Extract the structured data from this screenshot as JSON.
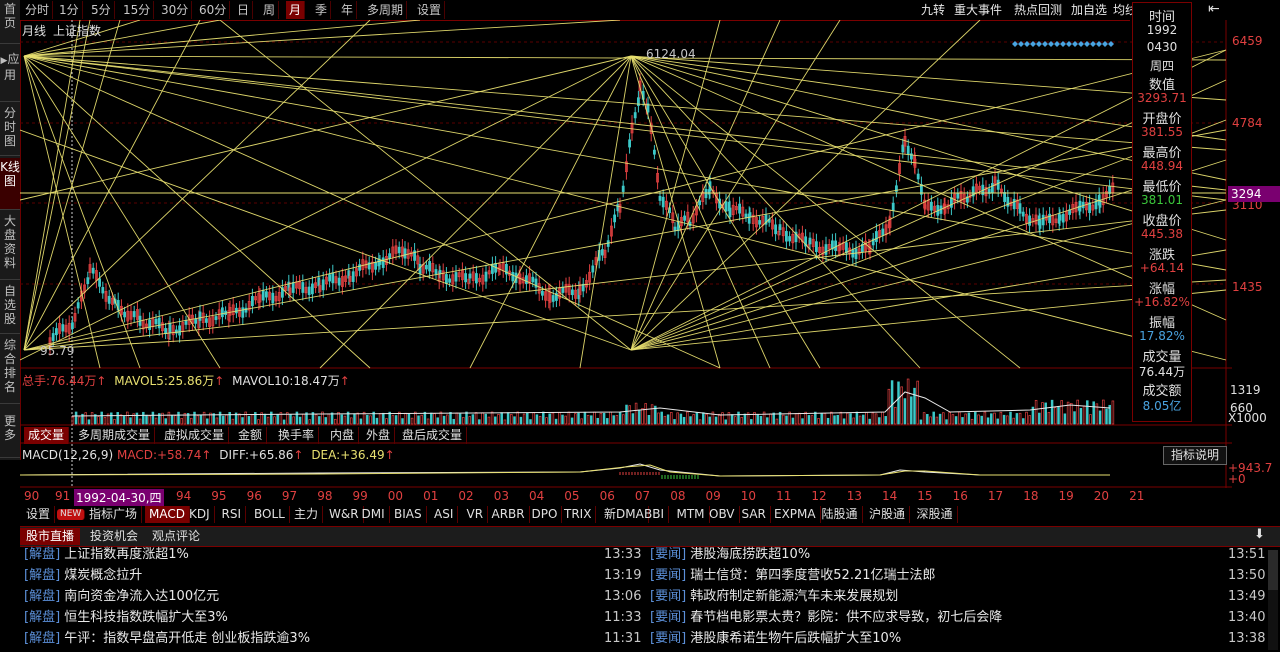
{
  "left_sidebar": [
    {
      "label": "首页"
    },
    {
      "label": "应用"
    },
    {
      "label": "分时图"
    },
    {
      "label": "K线图"
    },
    {
      "label": "大盘资料"
    },
    {
      "label": "自选股"
    },
    {
      "label": "综合排名"
    },
    {
      "label": "更多"
    }
  ],
  "period_tabs": [
    "分时",
    "1分",
    "5分",
    "15分",
    "30分",
    "60分",
    "日",
    "周",
    "月",
    "季",
    "年",
    "多周期",
    "设置"
  ],
  "period_selected": "月",
  "right_tabs": [
    "九转",
    "重大事件",
    "热点回测",
    "加自选",
    "均线"
  ],
  "chart": {
    "period_label": "月线",
    "index_name": "上证指数",
    "high_label": "6124.04",
    "low_label": "95.79",
    "right_axis": [
      "6459",
      "4784",
      "3110",
      "1435"
    ],
    "current_price_badge": "3294",
    "volume_axis": [
      "1319",
      "660",
      "X1000"
    ],
    "macd_axis": [
      "+943.7",
      "+0"
    ],
    "x_axis_years": [
      "90",
      "91",
      "94",
      "95",
      "96",
      "97",
      "98",
      "99",
      "00",
      "01",
      "02",
      "03",
      "04",
      "05",
      "06",
      "07",
      "08",
      "09",
      "10",
      "11",
      "12",
      "13",
      "14",
      "15",
      "16",
      "17",
      "18",
      "19",
      "20",
      "21"
    ],
    "cursor_date": "1992-04-30,四"
  },
  "volume_header": {
    "label": "总手:",
    "value": "76.44万",
    "ma5_label": "MAVOL5:",
    "ma5_value": "25.86万",
    "ma10_label": "MAVOL10:",
    "ma10_value": "18.47万"
  },
  "volume_tabs": [
    "成交量",
    "多周期成交量",
    "虚拟成交量",
    "金额",
    "换手率",
    "内盘",
    "外盘",
    "盘后成交量"
  ],
  "macd_header": {
    "label": "MACD(12,26,9)",
    "macd_label": "MACD:",
    "macd_value": "+58.74",
    "diff_label": "DIFF:",
    "diff_value": "+65.86",
    "dea_label": "DEA:",
    "dea_value": "+36.49",
    "indicator_help": "指标说明"
  },
  "indicator_tabs": [
    "设置",
    "NEW",
    "指标广场",
    "MACD",
    "KDJ",
    "RSI",
    "BOLL",
    "主力",
    "W&R",
    "DMI",
    "BIAS",
    "ASI",
    "VR",
    "ARBR",
    "DPO",
    "TRIX",
    "新DMA",
    "BBI",
    "MTM",
    "OBV",
    "SAR",
    "EXPMA",
    "陆股通",
    "沪股通",
    "深股通"
  ],
  "indicator_selected": "MACD",
  "info_panel": [
    {
      "key": "时间",
      "value": "1992",
      "color": "#e0e0e0"
    },
    {
      "key": "",
      "value": "0430",
      "color": "#e0e0e0"
    },
    {
      "key": "",
      "value": "周四",
      "color": "#e0e0e0"
    },
    {
      "key": "数值",
      "value": "3293.71",
      "color": "#e04040"
    },
    {
      "key": "开盘价",
      "value": "381.55",
      "color": "#e04040"
    },
    {
      "key": "最高价",
      "value": "448.94",
      "color": "#e04040"
    },
    {
      "key": "最低价",
      "value": "381.01",
      "color": "#3cc83c"
    },
    {
      "key": "收盘价",
      "value": "445.38",
      "color": "#e04040"
    },
    {
      "key": "涨跌",
      "value": "+64.14",
      "color": "#e04040"
    },
    {
      "key": "涨幅",
      "value": "+16.82%",
      "color": "#e04040"
    },
    {
      "key": "振幅",
      "value": "17.82%",
      "color": "#4aa3e0"
    },
    {
      "key": "成交量",
      "value": "76.44万",
      "color": "#e0e0e0"
    },
    {
      "key": "成交额",
      "value": "8.05亿",
      "color": "#4aa3e0"
    }
  ],
  "news_tabs": [
    "股市直播",
    "投资机会",
    "观点评论"
  ],
  "news_left": [
    {
      "tag": "[解盘]",
      "title": "上证指数再度涨超1%",
      "time": "13:33"
    },
    {
      "tag": "[解盘]",
      "title": "煤炭概念拉升",
      "time": "13:19"
    },
    {
      "tag": "[解盘]",
      "title": "南向资金净流入达100亿元",
      "time": "13:06"
    },
    {
      "tag": "[解盘]",
      "title": "恒生科技指数跌幅扩大至3%",
      "time": "11:33"
    },
    {
      "tag": "[解盘]",
      "title": "午评：指数早盘高开低走 创业板指跌逾3%",
      "time": "11:31"
    }
  ],
  "news_right": [
    {
      "tag": "[要闻]",
      "title": "港股海底捞跌超10%",
      "time": "13:51"
    },
    {
      "tag": "[要闻]",
      "title": "瑞士信贷：第四季度营收52.21亿瑞士法郎",
      "time": "13:50"
    },
    {
      "tag": "[要闻]",
      "title": "韩政府制定新能源汽车未来发展规划",
      "time": "13:49"
    },
    {
      "tag": "[要闻]",
      "title": "春节档电影票太贵？影院：供不应求导致，初七后会降",
      "time": "13:40"
    },
    {
      "tag": "[要闻]",
      "title": "港股康希诺生物午后跌幅扩大至10%",
      "time": "13:38"
    }
  ],
  "colors": {
    "up": "#e04040",
    "down": "#3cc8c8",
    "gann": "#e8e070",
    "accent": "#7a0000",
    "badge": "#7a0070"
  }
}
